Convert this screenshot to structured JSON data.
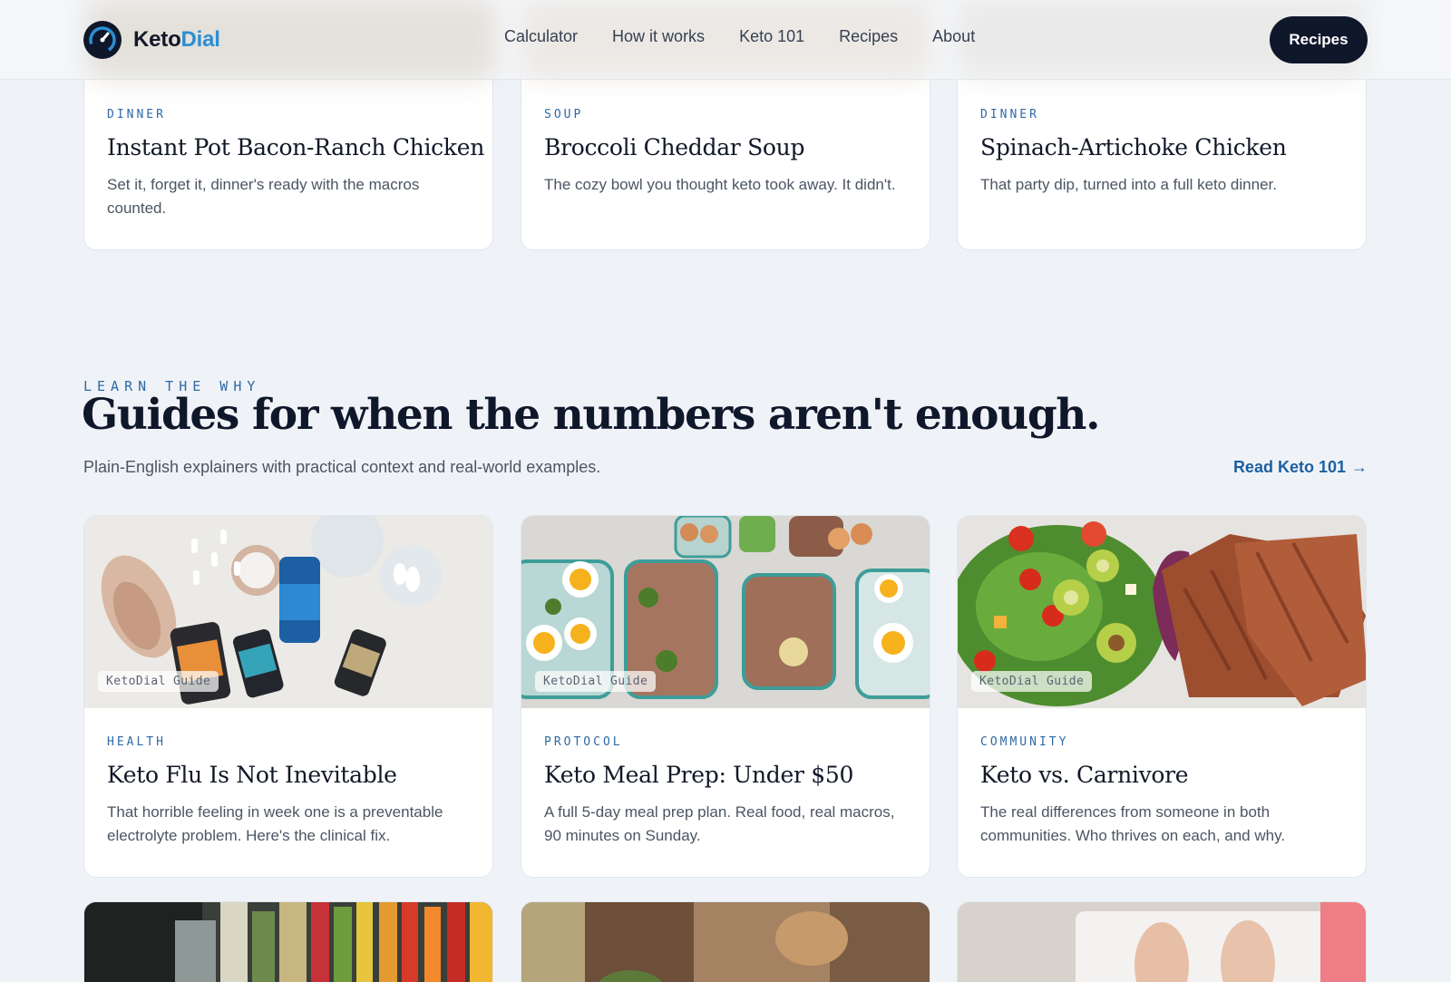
{
  "header": {
    "brand_part1": "Keto",
    "brand_part2": "Dial",
    "nav": [
      "Calculator",
      "How it works",
      "Keto 101",
      "Recipes",
      "About"
    ],
    "cta_label": "Recipes"
  },
  "recipes": [
    {
      "category": "DINNER",
      "title": "Instant Pot Bacon-Ranch Chicken",
      "description": "Set it, forget it, dinner's ready with the macros counted."
    },
    {
      "category": "SOUP",
      "title": "Broccoli Cheddar Soup",
      "description": "The cozy bowl you thought keto took away. It didn't."
    },
    {
      "category": "DINNER",
      "title": "Spinach-Artichoke Chicken",
      "description": "That party dip, turned into a full keto dinner."
    }
  ],
  "guides_section": {
    "kicker": "LEARN THE WHY",
    "title": "Guides for when the numbers aren't enough.",
    "subtitle": "Plain-English explainers with practical context and real-world examples.",
    "link_label": "Read Keto 101",
    "link_arrow": "→"
  },
  "guides": [
    {
      "badge": "KetoDial Guide",
      "category": "HEALTH",
      "title": "Keto Flu Is Not Inevitable",
      "description": "That horrible feeling in week one is a preventable electrolyte problem. Here's the clinical fix."
    },
    {
      "badge": "KetoDial Guide",
      "category": "PROTOCOL",
      "title": "Keto Meal Prep: Under $50",
      "description": "A full 5-day meal prep plan. Real food, real macros, 90 minutes on Sunday."
    },
    {
      "badge": "KetoDial Guide",
      "category": "COMMUNITY",
      "title": "Keto vs. Carnivore",
      "description": "The real differences from someone in both communities. Who thrives on each, and why."
    }
  ],
  "colors": {
    "background": "#eff3f8",
    "accent": "#2b8fd4",
    "eyebrow": "#2e6aa6",
    "dark": "#0f172a"
  }
}
